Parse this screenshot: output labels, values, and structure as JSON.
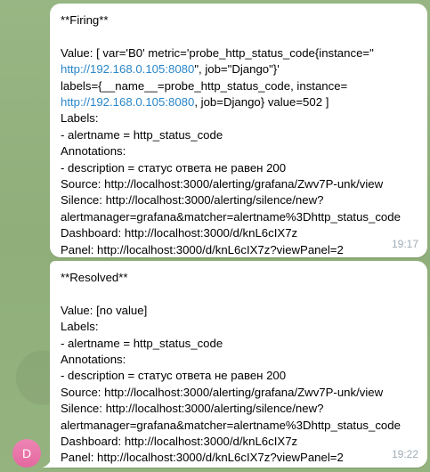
{
  "colors": {
    "background": "#93b37f",
    "bubble": "#ffffff",
    "link": "#2a86c8",
    "timestamp": "#a0acb6",
    "avatar": "#e3689e"
  },
  "avatar": {
    "initial": "D"
  },
  "messages": [
    {
      "heading": "**Firing**",
      "value_prefix": "Value: [ var='B0' metric='probe_http_status_code{instance=\"",
      "value_link": "http://192.168.0.105:8080",
      "value_suffix": "\", job=\"Django\"}'",
      "labels_prefix": "labels={__name__=probe_http_status_code, instance=",
      "labels_link": "http://192.168.0.105:8080",
      "labels_suffix": ", job=Django} value=502 ]",
      "labels_heading": "Labels:",
      "alertname": " - alertname = http_status_code",
      "annotations_heading": "Annotations:",
      "description": " - description = статус ответа не равен 200",
      "source": "Source: http://localhost:3000/alerting/grafana/Zwv7P-unk/view",
      "silence_1": "Silence: http://localhost:3000/alerting/silence/new?",
      "silence_2": "alertmanager=grafana&matcher=alertname%3Dhttp_status_code",
      "dashboard": "Dashboard: http://localhost:3000/d/knL6cIX7z",
      "panel": "Panel: http://localhost:3000/d/knL6cIX7z?viewPanel=2",
      "time": "19:17"
    },
    {
      "heading": "**Resolved**",
      "value": "Value: [no value]",
      "labels_heading": "Labels:",
      "alertname": " - alertname = http_status_code",
      "annotations_heading": "Annotations:",
      "description": " - description = статус ответа не равен 200",
      "source": "Source: http://localhost:3000/alerting/grafana/Zwv7P-unk/view",
      "silence_1": "Silence: http://localhost:3000/alerting/silence/new?",
      "silence_2": "alertmanager=grafana&matcher=alertname%3Dhttp_status_code",
      "dashboard": "Dashboard: http://localhost:3000/d/knL6cIX7z",
      "panel": "Panel: http://localhost:3000/d/knL6cIX7z?viewPanel=2",
      "time": "19:22"
    }
  ]
}
